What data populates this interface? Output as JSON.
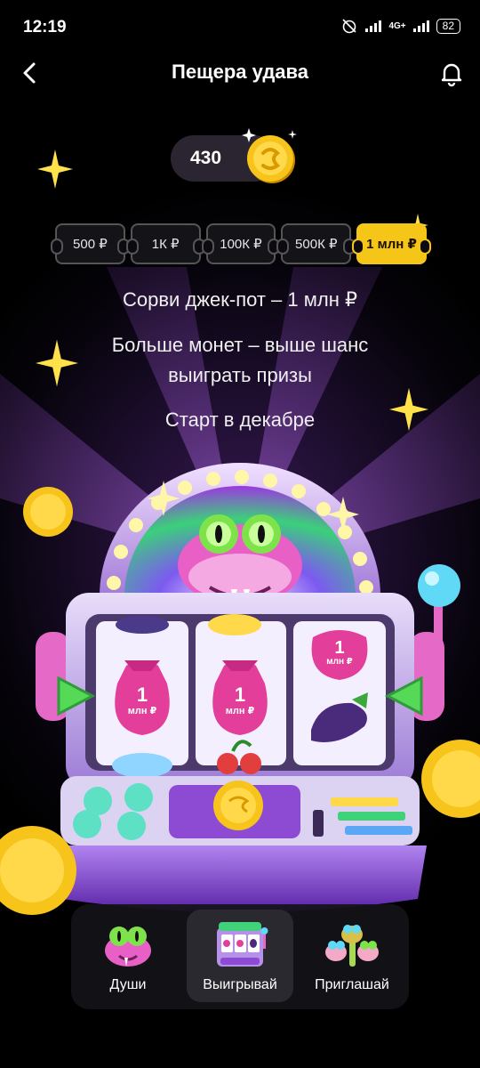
{
  "status_bar": {
    "time": "12:19",
    "network": "4G+",
    "battery": "82"
  },
  "header": {
    "title": "Пещера удава",
    "back_icon": "chevron-left-icon",
    "bell_icon": "bell-icon"
  },
  "balance": {
    "value": "430",
    "icon": "coin-icon"
  },
  "tickets": [
    {
      "label": "500 ₽",
      "active": false
    },
    {
      "label": "1К ₽",
      "active": false
    },
    {
      "label": "100К ₽",
      "active": false
    },
    {
      "label": "500К ₽",
      "active": false
    },
    {
      "label": "1 млн ₽",
      "active": true
    }
  ],
  "info": {
    "jackpot": "Сорви джек-пот – 1 млн ₽",
    "more_coins_line1": "Больше монет – выше шанс",
    "more_coins_line2": "выиграть призы",
    "start": "Старт в декабре"
  },
  "slot_machine": {
    "reel_badge_value": "1",
    "reel_badge_unit": "млн ₽",
    "reel_badge_unit_short": "млн ₽"
  },
  "nav": {
    "items": [
      {
        "label": "Души",
        "icon": "snake-icon",
        "active": false
      },
      {
        "label": "Выигрывай",
        "icon": "slot-machine-icon",
        "active": true
      },
      {
        "label": "Приглашай",
        "icon": "snake-friends-icon",
        "active": false
      }
    ]
  },
  "colors": {
    "accent_gold": "#f5c518",
    "ticket_border": "#555555",
    "slot_purple": "#b592e8",
    "snake_pink": "#e85fc6",
    "snake_green": "#7ee34a"
  }
}
